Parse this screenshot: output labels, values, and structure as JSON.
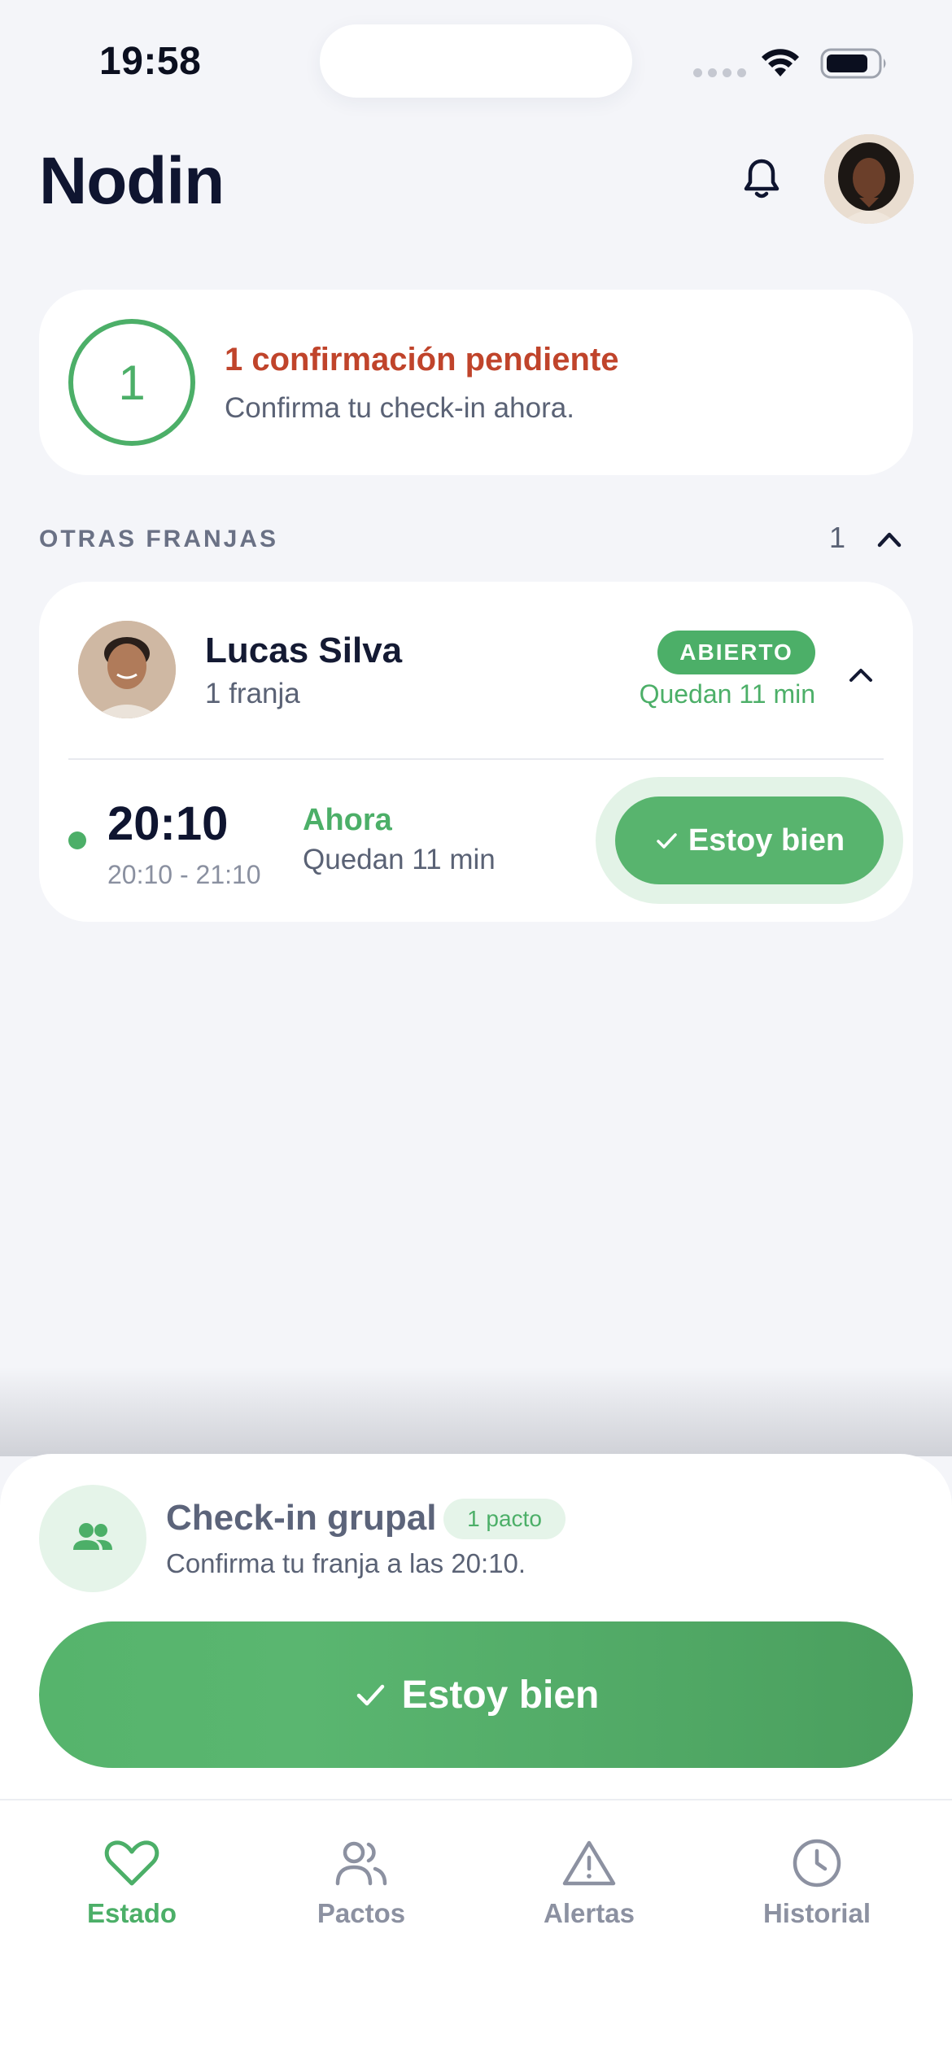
{
  "status_bar": {
    "time": "19:58"
  },
  "header": {
    "title": "Nodin",
    "icons": [
      "bell-icon",
      "avatar"
    ]
  },
  "pending": {
    "count": "1",
    "title": "1 confirmación pendiente",
    "subtitle": "Confirma tu check-in ahora."
  },
  "section": {
    "label": "OTRAS FRANJAS",
    "count": "1"
  },
  "person": {
    "name": "Lucas Silva",
    "slots_label": "1 franja",
    "status": "ABIERTO",
    "remaining": "Quedan 11 min",
    "slot": {
      "time": "20:10",
      "range": "20:10 - 21:10",
      "now_label": "Ahora",
      "remaining": "Quedan 11 min",
      "button": "Estoy bien"
    }
  },
  "sheet": {
    "title": "Check-in grupal",
    "badge": "1 pacto",
    "subtitle": "Confirma tu franja a las 20:10.",
    "button": "Estoy bien"
  },
  "tabs": [
    {
      "label": "Estado",
      "icon": "heart-icon",
      "active": true
    },
    {
      "label": "Pactos",
      "icon": "users-icon",
      "active": false
    },
    {
      "label": "Alertas",
      "icon": "alert-triangle-icon",
      "active": false
    },
    {
      "label": "Historial",
      "icon": "clock-icon",
      "active": false
    }
  ],
  "colors": {
    "accent": "#4caf68",
    "warning_text": "#c0442b",
    "background": "#f4f5f9"
  }
}
